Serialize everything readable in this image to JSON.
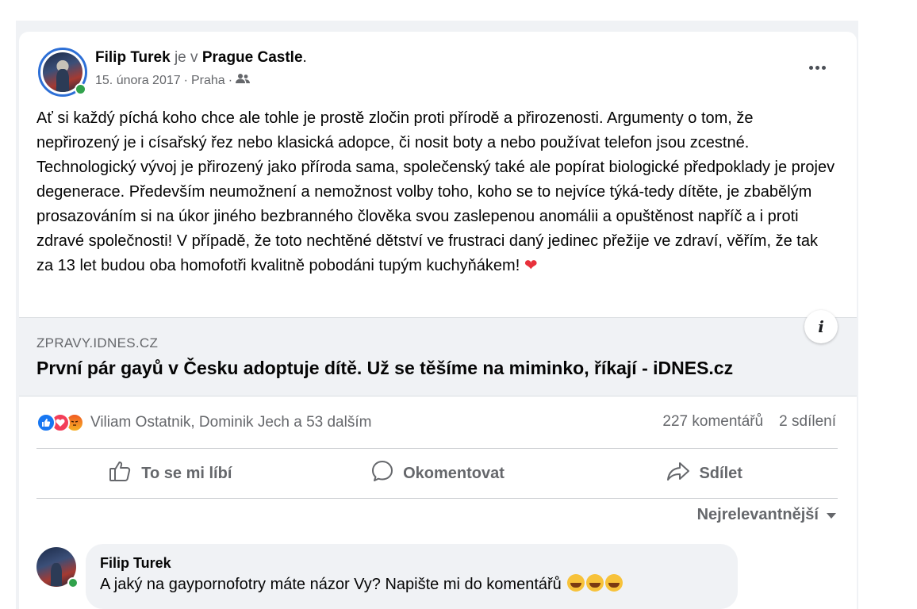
{
  "post": {
    "author": "Filip Turek",
    "location_prefix": "je v",
    "location": "Prague Castle",
    "location_suffix": ".",
    "date": "15. února 2017",
    "place": "Praha",
    "audience_icon": "friends-icon",
    "body": "Ať si každý píchá koho chce ale tohle je prostě zločin proti přírodě a přirozenosti. Argumenty o tom, že nepřirozený je i císařský řez nebo klasická adopce, či nosit boty a nebo používat telefon jsou zcestné. Technologický vývoj je přirozený jako příroda sama, společenský také ale popírat biologické předpoklady je projev degenerace. Především neumožnení a nemožnost volby toho, koho se to nejvíce týká-tedy dítěte, je zbabělým prosazováním si na úkor jiného bezbranného člověka svou zaslepenou anomálii a opuštěnost napříč a i proti zdravé společnosti! V případě, že toto nechtěné dětství ve frustraci daný jedinec přežije ve zdraví, věřím, že tak za 13 let budou oba homofotři kvalitně pobodáni tupým kuchyňákem!",
    "body_emoji": "❤"
  },
  "link": {
    "domain": "ZPRAVY.IDNES.CZ",
    "title": "První pár gayů v Česku adoptuje dítě. Už se těšíme na miminko, říkají - iDNES.cz",
    "info_glyph": "i"
  },
  "engagement": {
    "reaction_names": "Viliam Ostatnik, Dominik Jech a 53 dalším",
    "comments": "227 komentářů",
    "shares": "2 sdílení"
  },
  "actions": {
    "like": "To se mi líbí",
    "comment": "Okomentovat",
    "share": "Sdílet"
  },
  "sort_label": "Nejrelevantnější",
  "comment": {
    "author": "Filip Turek",
    "text": "A jaký na gaypornofotry máte názor Vy? Napište mi do komentářů"
  },
  "colors": {
    "online": "#31a24c",
    "like": "#1877f2",
    "love": "#f33e58",
    "muted_text": "#65676b",
    "preview_bg": "#f0f2f5"
  }
}
